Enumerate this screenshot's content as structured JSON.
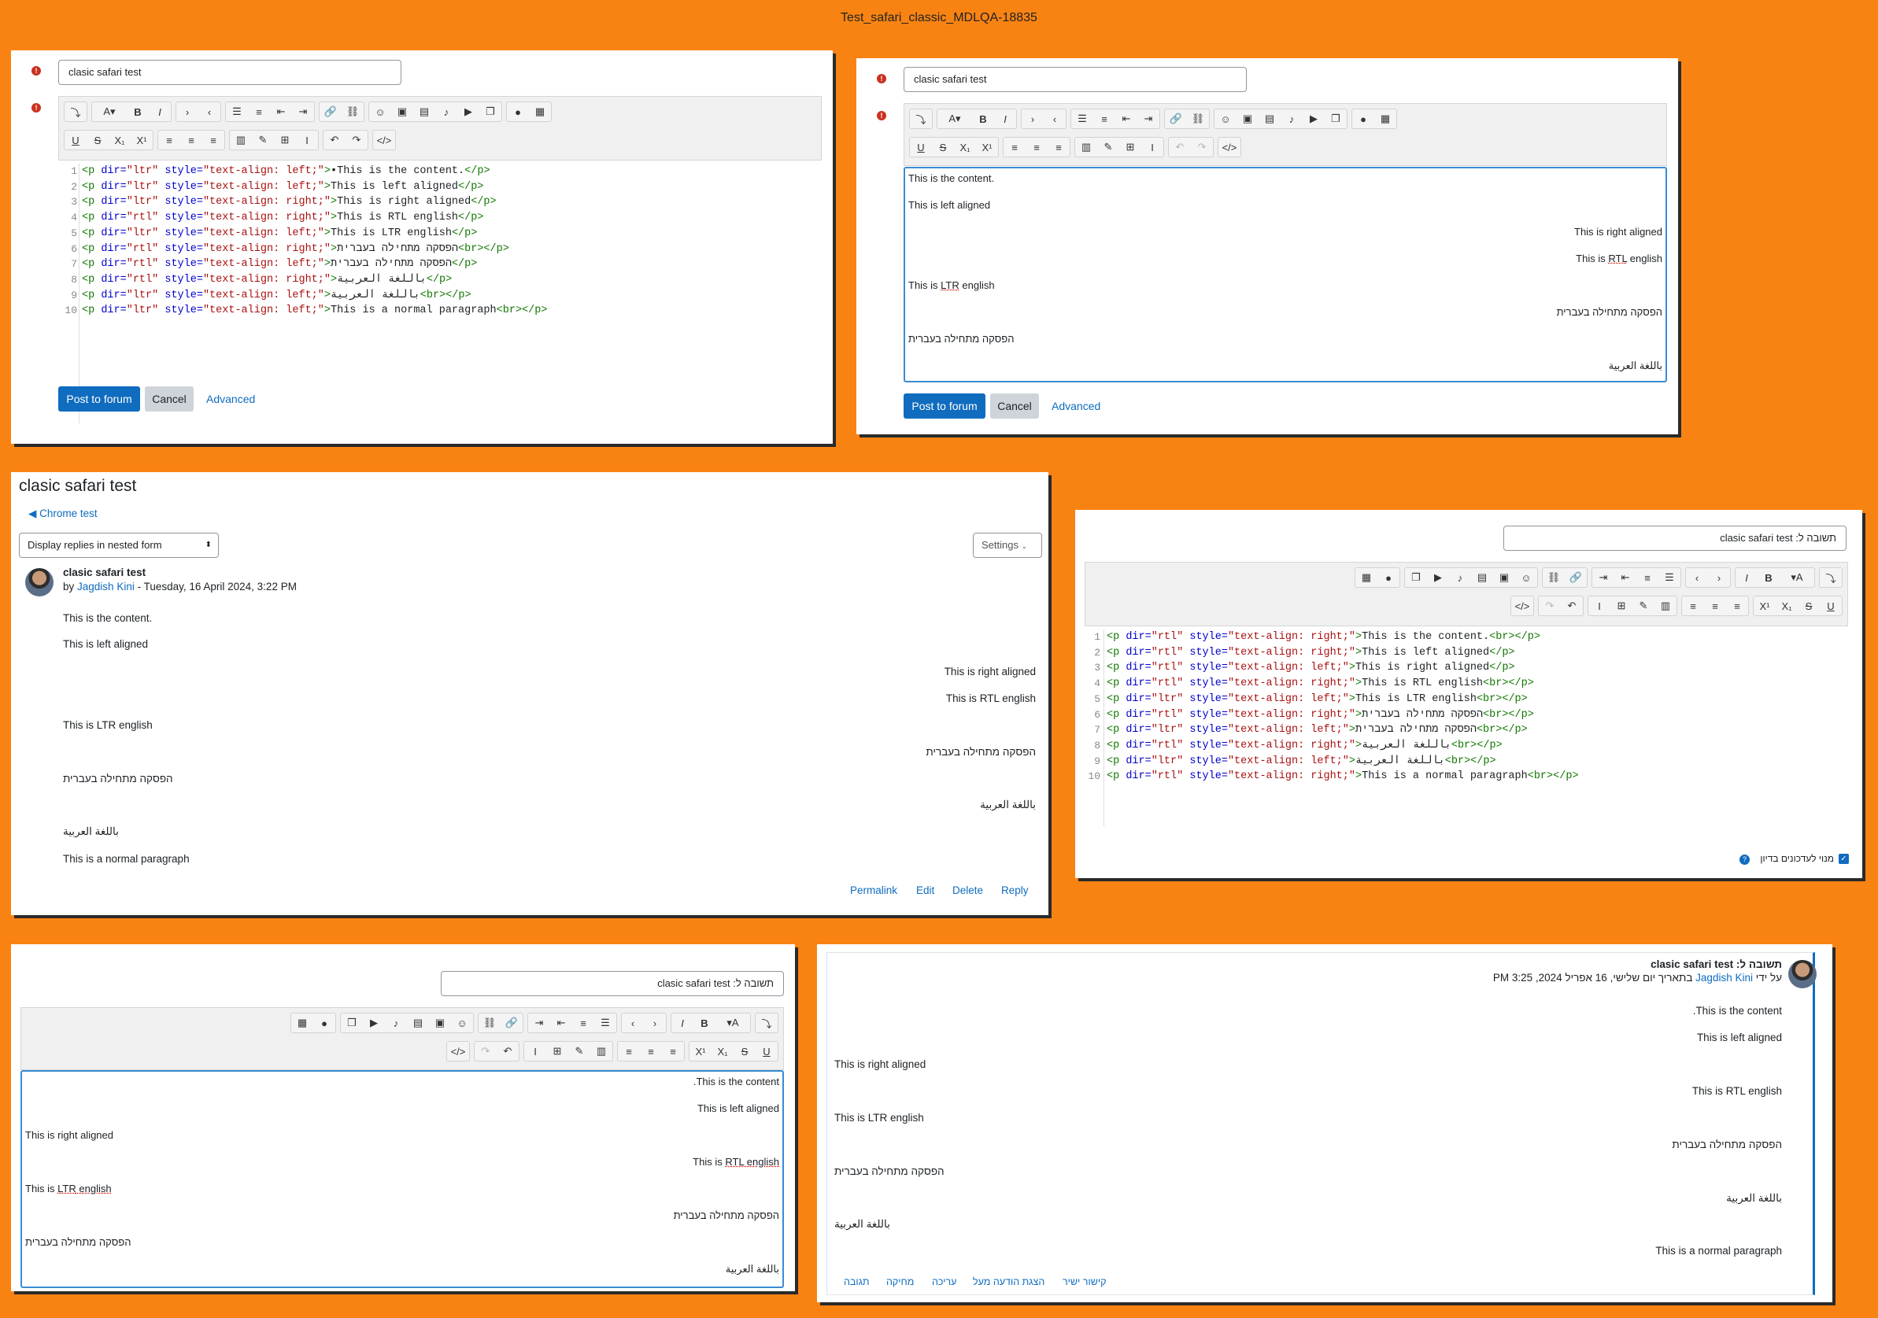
{
  "page": {
    "title": "Test_safari_classic_MDLQA-18835"
  },
  "subject": "clasic safari test",
  "subject_he": "תשובה ל: clasic safari test",
  "buttons": {
    "post": "Post to forum",
    "cancel": "Cancel",
    "advanced": "Advanced"
  },
  "code_lines": [
    {
      "n": "1",
      "dir": "ltr",
      "align": "left",
      "text": "•This is the content."
    },
    {
      "n": "2",
      "dir": "ltr",
      "align": "left",
      "text": "This is left aligned"
    },
    {
      "n": "3",
      "dir": "ltr",
      "align": "right",
      "text": "This is right aligned"
    },
    {
      "n": "4",
      "dir": "rtl",
      "align": "right",
      "text": "This is RTL english"
    },
    {
      "n": "5",
      "dir": "ltr",
      "align": "left",
      "text": "This is LTR english"
    },
    {
      "n": "6",
      "dir": "rtl",
      "align": "right",
      "text": "הפסקה מתחילה בעברית",
      "br": true
    },
    {
      "n": "7",
      "dir": "rtl",
      "align": "left",
      "text": "הפסקה מתחילה בעברית"
    },
    {
      "n": "8",
      "dir": "rtl",
      "align": "right",
      "text": "باللغة العربية"
    },
    {
      "n": "9",
      "dir": "ltr",
      "align": "left",
      "text": "باللغة العربية",
      "br": true
    },
    {
      "n": "10",
      "dir": "ltr",
      "align": "left",
      "text": "This is a normal paragraph",
      "br": true
    }
  ],
  "code_lines_rtl": [
    {
      "n": "1",
      "dir": "rtl",
      "align": "right",
      "text": "This is the content.",
      "br": true
    },
    {
      "n": "2",
      "dir": "rtl",
      "align": "right",
      "text": "This is left aligned"
    },
    {
      "n": "3",
      "dir": "rtl",
      "align": "left",
      "text": "This is right aligned"
    },
    {
      "n": "4",
      "dir": "rtl",
      "align": "right",
      "text": "This is RTL english",
      "br": true
    },
    {
      "n": "5",
      "dir": "ltr",
      "align": "left",
      "text": "This is LTR english",
      "br": true
    },
    {
      "n": "6",
      "dir": "rtl",
      "align": "right",
      "text": "הפסקה מתחילה בעברית",
      "br": true
    },
    {
      "n": "7",
      "dir": "ltr",
      "align": "left",
      "text": "הפסקה מתחילה בעברית",
      "br": true
    },
    {
      "n": "8",
      "dir": "rtl",
      "align": "right",
      "text": "باللغة العربية",
      "br": true
    },
    {
      "n": "9",
      "dir": "ltr",
      "align": "left",
      "text": "باللغة العربية",
      "br": true
    },
    {
      "n": "10",
      "dir": "rtl",
      "align": "right",
      "text": "This is a normal paragraph",
      "br": true
    }
  ],
  "editor_lines": {
    "content": "This is the content.",
    "left": "This is left aligned",
    "right": "This is right aligned",
    "rtl_pre": "This is ",
    "rtl_word": "RTL",
    "rtl_post": " english",
    "ltr_pre": "This is ",
    "ltr_word": "LTR",
    "ltr_post": " english",
    "he": "הפסקה מתחילה בעברית",
    "ar": "باللغة العربية",
    "normal": "This is a normal paragraph",
    "content_rtl": ".This is the content",
    "content_rtl2": "This is the content."
  },
  "discussion": {
    "title": "clasic safari test",
    "back_link": "Chrome test",
    "display_select": "Display replies in nested form",
    "settings": "Settings",
    "post_title": "clasic safari test",
    "by": "by",
    "author": "Jagdish Kini",
    "date": " - Tuesday, 16 April 2024, 3:22 PM",
    "actions": {
      "permalink": "Permalink",
      "edit": "Edit",
      "delete": "Delete",
      "reply": "Reply"
    }
  },
  "rtl_post": {
    "title": "תשובה ל: clasic safari test",
    "by": "על ידי",
    "author": "Jagdish Kini",
    "date": "בתאריך יום שלישי, 16 אפריל 2024, 3:25 PM",
    "actions": {
      "reply": "תגובה",
      "delete": "מחיקה",
      "edit": "עריכה",
      "parent": "הצגת הודעה מעל",
      "permalink": "קישור ישיר"
    }
  },
  "subscribe_label": "מנוי לעדכונים בדיון"
}
